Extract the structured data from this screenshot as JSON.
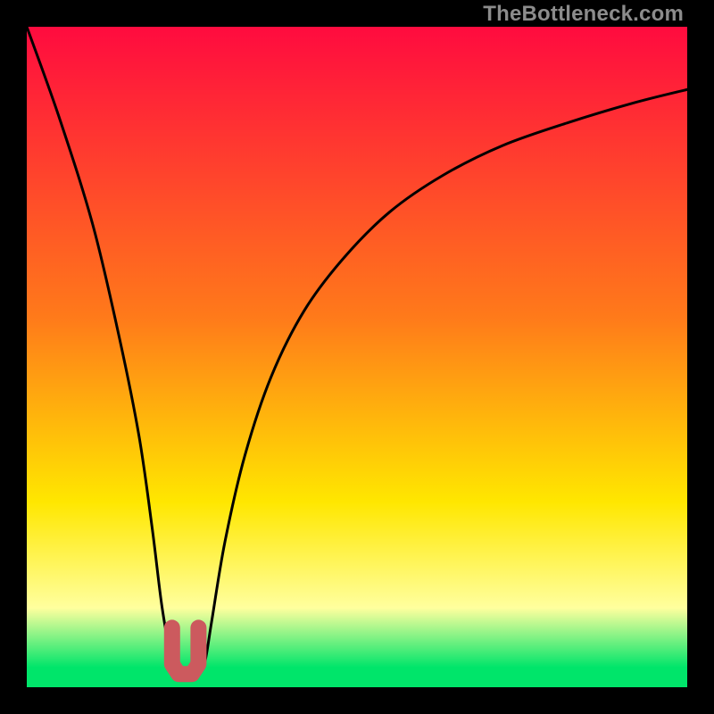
{
  "watermark": "TheBottleneck.com",
  "colors": {
    "frame": "#000000",
    "gradient_top": "#ff0b3f",
    "gradient_mid_orange": "#ff7a1a",
    "gradient_yellow": "#ffe700",
    "gradient_pale_yellow": "#ffff9e",
    "gradient_green": "#00e56a",
    "curve": "#000000",
    "marker": "#cc5a5e"
  },
  "chart_data": {
    "type": "line",
    "title": "",
    "xlabel": "",
    "ylabel": "",
    "x_range": [
      0,
      100
    ],
    "y_range": [
      0,
      100
    ],
    "series": [
      {
        "name": "bottleneck-curve",
        "x": [
          0,
          5,
          10,
          14,
          17,
          19,
          20.5,
          22,
          23,
          24,
          25,
          26,
          27,
          28,
          30,
          33,
          37,
          42,
          48,
          55,
          63,
          72,
          82,
          92,
          100
        ],
        "y": [
          100,
          86,
          70,
          53,
          38,
          24,
          12,
          4,
          2,
          2,
          2,
          2,
          4,
          10,
          22,
          35,
          47,
          57,
          65,
          72,
          77.5,
          82,
          85.5,
          88.5,
          90.5
        ]
      }
    ],
    "marker": {
      "name": "optimal-range-u",
      "x": [
        22,
        22,
        23,
        25,
        26,
        26
      ],
      "y": [
        9,
        3.5,
        2,
        2,
        3.5,
        9
      ]
    },
    "gradient_stops_pct": [
      {
        "pct": 0,
        "key": "gradient_top"
      },
      {
        "pct": 44,
        "key": "gradient_mid_orange"
      },
      {
        "pct": 72,
        "key": "gradient_yellow"
      },
      {
        "pct": 88,
        "key": "gradient_pale_yellow"
      },
      {
        "pct": 97,
        "key": "gradient_green"
      },
      {
        "pct": 100,
        "key": "gradient_green"
      }
    ]
  }
}
